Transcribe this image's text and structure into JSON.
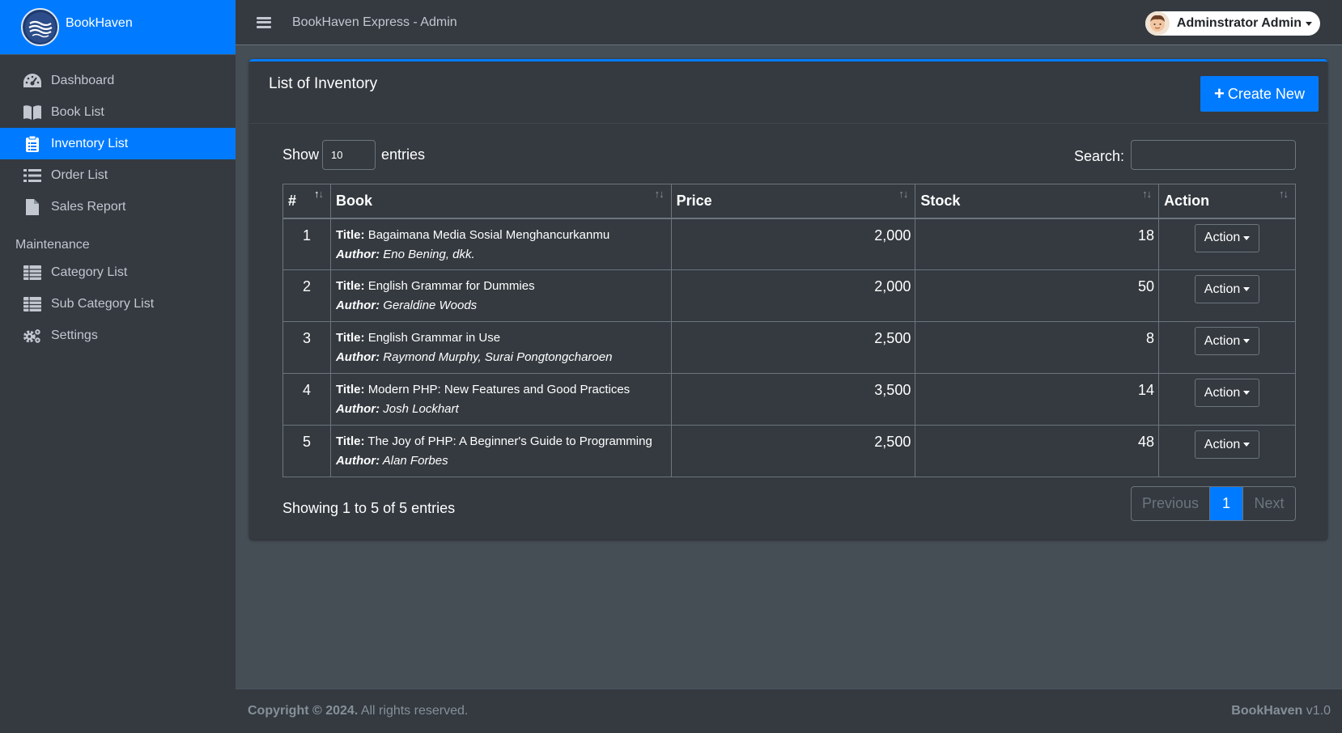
{
  "brand": {
    "name": "BookHaven"
  },
  "topbar": {
    "title": "BookHaven Express - Admin",
    "user": "Adminstrator Admin"
  },
  "sidebar": {
    "items": [
      {
        "label": "Dashboard",
        "icon": "dashboard-icon"
      },
      {
        "label": "Book List",
        "icon": "book-icon"
      },
      {
        "label": "Inventory List",
        "icon": "clipboard-icon",
        "active": true
      },
      {
        "label": "Order List",
        "icon": "list-icon"
      },
      {
        "label": "Sales Report",
        "icon": "file-icon"
      }
    ],
    "maintenance_header": "Maintenance",
    "maintenance_items": [
      {
        "label": "Category List",
        "icon": "table-icon"
      },
      {
        "label": "Sub Category List",
        "icon": "table-icon"
      },
      {
        "label": "Settings",
        "icon": "gears-icon"
      }
    ]
  },
  "card": {
    "title": "List of Inventory",
    "create_label": "Create New"
  },
  "table_controls": {
    "show_label": "Show",
    "length_value": "10",
    "entries_label": "entries",
    "search_label": "Search:",
    "search_value": ""
  },
  "table": {
    "headers": [
      "#",
      "Book",
      "Price",
      "Stock",
      "Action"
    ],
    "title_prefix": "Title:",
    "author_prefix": "Author:",
    "rows": [
      {
        "num": "1",
        "title": "Bagaimana Media Sosial Menghancurkanmu",
        "author": "Eno Bening, dkk.",
        "price": "2,000",
        "stock": "18",
        "action": "Action"
      },
      {
        "num": "2",
        "title": "English Grammar for Dummies",
        "author": "Geraldine Woods",
        "price": "2,000",
        "stock": "50",
        "action": "Action"
      },
      {
        "num": "3",
        "title": "English Grammar in Use",
        "author": "Raymond Murphy, Surai Pongtongcharoen",
        "price": "2,500",
        "stock": "8",
        "action": "Action"
      },
      {
        "num": "4",
        "title": "Modern PHP: New Features and Good Practices",
        "author": "Josh Lockhart",
        "price": "3,500",
        "stock": "14",
        "action": "Action"
      },
      {
        "num": "5",
        "title": "The Joy of PHP: A Beginner's Guide to Programming",
        "author": "Alan Forbes",
        "price": "2,500",
        "stock": "48",
        "action": "Action"
      }
    ]
  },
  "table_info": "Showing 1 to 5 of 5 entries",
  "pagination": {
    "previous": "Previous",
    "current": "1",
    "next": "Next"
  },
  "footer": {
    "copyright": "Copyright © 2024.",
    "rights": "All rights reserved.",
    "brand": "BookHaven",
    "version": "v1.0"
  },
  "colors": {
    "primary": "#007bff",
    "sidebar_bg": "#343a40",
    "content_bg": "#454d55"
  }
}
